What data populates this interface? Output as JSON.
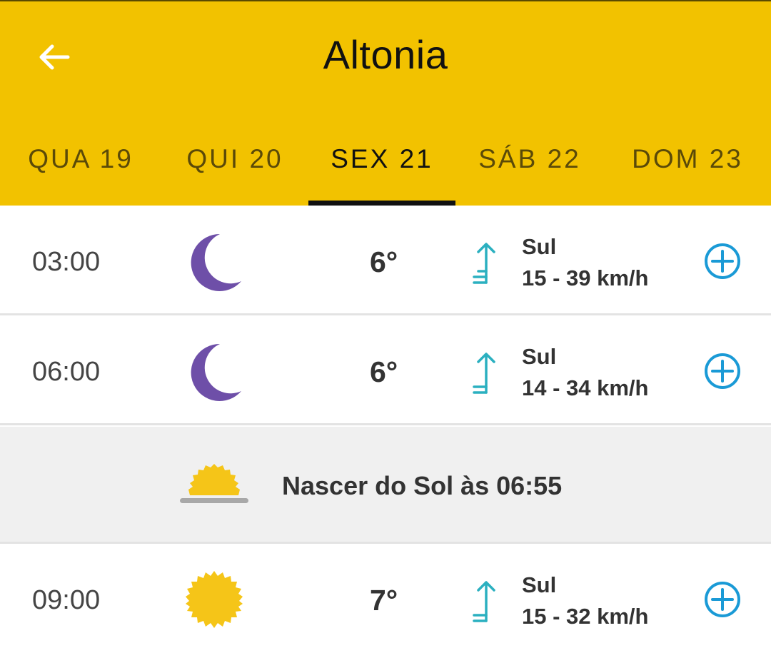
{
  "header": {
    "title": "Altonia",
    "background_color": "#f2c200",
    "back_icon": "arrow-left-icon"
  },
  "tabs": [
    {
      "label": "QUA 19",
      "active": false
    },
    {
      "label": "QUI 20",
      "active": false
    },
    {
      "label": "SEX 21",
      "active": true
    },
    {
      "label": "SÁB 22",
      "active": false
    },
    {
      "label": "DOM 23",
      "active": false
    }
  ],
  "rows": [
    {
      "time": "03:00",
      "icon": "moon-icon",
      "temp": "6°",
      "wind_dir": "Sul",
      "wind_speed": "15 - 39 km/h"
    },
    {
      "time": "06:00",
      "icon": "moon-icon",
      "temp": "6°",
      "wind_dir": "Sul",
      "wind_speed": "14 - 34 km/h"
    },
    {
      "time": "09:00",
      "icon": "sun-icon",
      "temp": "7°",
      "wind_dir": "Sul",
      "wind_speed": "15 - 32 km/h"
    }
  ],
  "sunrise": {
    "text": "Nascer do Sol às 06:55",
    "icon": "sunrise-icon"
  },
  "colors": {
    "accent": "#f2c200",
    "moon": "#6e4fa8",
    "sun": "#f5c518",
    "wind": "#2bb0c0",
    "plus": "#1a9ad6"
  }
}
